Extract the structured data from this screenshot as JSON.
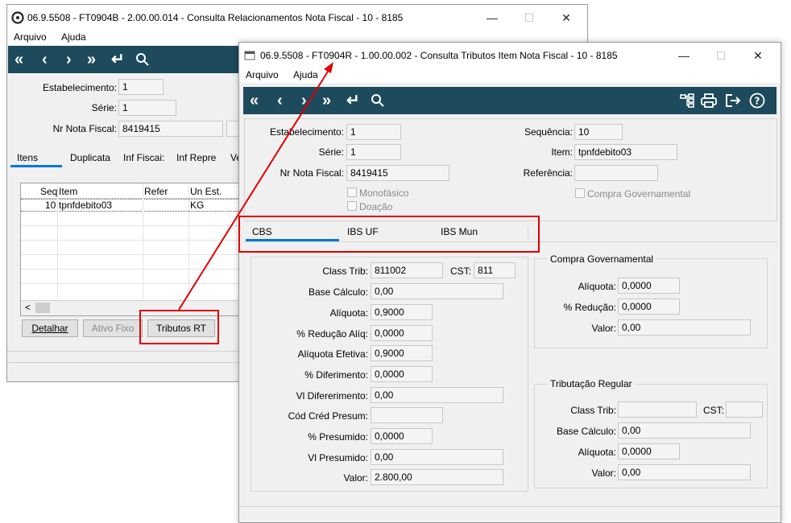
{
  "back_window": {
    "title": "06.9.5508 - FT0904B - 2.00.00.014 - Consulta Relacionamentos Nota Fiscal - 10 - 8185",
    "menu": [
      "Arquivo",
      "Ajuda"
    ],
    "fields": {
      "estabelecimento_label": "Estabelecimento:",
      "estabelecimento_value": "1",
      "serie_label": "Série:",
      "serie_value": "1",
      "nr_nota_label": "Nr Nota Fiscal:",
      "nr_nota_value": "8419415"
    },
    "tabs": [
      "Itens",
      "Duplicata",
      "Inf Fiscai:",
      "Inf Repre",
      "Ve"
    ],
    "grid": {
      "columns": [
        "Seq",
        "Item",
        "Refer",
        "Un Est."
      ],
      "rows": [
        {
          "seq": "10",
          "item": "tpnfdebito03",
          "refer": "",
          "un": "KG"
        }
      ]
    },
    "buttons": {
      "detalhar": "Detalhar",
      "ativo_fixo": "Ativo Fixo",
      "tributos_rt": "Tributos RT"
    },
    "scroll_left": "<"
  },
  "front_window": {
    "title": "06.9.5508 - FT0904R - 1.00.00.002 - Consulta Tributos Item Nota Fiscal - 10 - 8185",
    "menu": [
      "Arquivo",
      "Ajuda"
    ],
    "header": {
      "estabelecimento_label": "Estabelecimento:",
      "estabelecimento_value": "1",
      "serie_label": "Série:",
      "serie_value": "1",
      "nr_nota_label": "Nr Nota Fiscal:",
      "nr_nota_value": "8419415",
      "sequencia_label": "Sequência:",
      "sequencia_value": "10",
      "item_label": "Item:",
      "item_value": "tpnfdebito03",
      "referencia_label": "Referência:",
      "referencia_value": "",
      "monofasico_label": "Monofásico",
      "doacao_label": "Doação",
      "compra_gov_label": "Compra Governamental"
    },
    "tabs": [
      "CBS",
      "IBS UF",
      "IBS Mun"
    ],
    "left": {
      "class_trib_label": "Class Trib:",
      "class_trib_value": "811002",
      "cst_label": "CST:",
      "cst_value": "811",
      "base_calculo_label": "Base Cálculo:",
      "base_calculo_value": "0,00",
      "aliquota_label": "Alíquota:",
      "aliquota_value": "0,9000",
      "reducao_aliq_label": "% Redução Alíq:",
      "reducao_aliq_value": "0,0000",
      "aliquota_efetiva_label": "Alíquota Efetiva:",
      "aliquota_efetiva_value": "0,9000",
      "diferimento_label": "% Diferimento:",
      "diferimento_value": "0,0000",
      "vl_diferimento_label": "Vl Difererimento:",
      "vl_diferimento_value": "0,00",
      "cod_cred_label": "Cód Créd Presum:",
      "cod_cred_value": "",
      "presumido_label": "% Presumido:",
      "presumido_value": "0,0000",
      "vl_presumido_label": "Vl Presumido:",
      "vl_presumido_value": "0,00",
      "valor_label": "Valor:",
      "valor_value": "2.800,00"
    },
    "compra_gov": {
      "title": "Compra Governamental",
      "aliquota_label": "Alíquota:",
      "aliquota_value": "0,0000",
      "reducao_label": "% Redução:",
      "reducao_value": "0,0000",
      "valor_label": "Valor:",
      "valor_value": "0,00"
    },
    "trib_regular": {
      "title": "Tributação Regular",
      "class_trib_label": "Class Trib:",
      "class_trib_value": "",
      "cst_label": "CST:",
      "cst_value": "",
      "base_calculo_label": "Base Cálculo:",
      "base_calculo_value": "0,00",
      "aliquota_label": "Alíquota:",
      "aliquota_value": "0,0000",
      "valor_label": "Valor:",
      "valor_value": "0,00"
    }
  },
  "colors": {
    "toolbar": "#1d4a5c",
    "tab_underline": "#0078d7",
    "annotation": "#e00000"
  }
}
